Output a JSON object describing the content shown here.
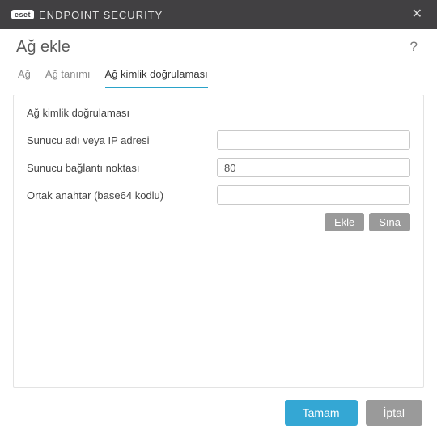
{
  "titlebar": {
    "brand_badge": "eset",
    "brand_text": "ENDPOINT SECURITY",
    "close_glyph": "✕"
  },
  "header": {
    "title": "Ağ ekle",
    "help_glyph": "?"
  },
  "tabs": [
    {
      "label": "Ağ",
      "active": false
    },
    {
      "label": "Ağ tanımı",
      "active": false
    },
    {
      "label": "Ağ kimlik doğrulaması",
      "active": true
    }
  ],
  "panel": {
    "section_heading": "Ağ kimlik doğrulaması",
    "rows": [
      {
        "label": "Sunucu adı veya IP adresi",
        "value": ""
      },
      {
        "label": "Sunucu bağlantı noktası",
        "value": "80"
      },
      {
        "label": "Ortak anahtar (base64 kodlu)",
        "value": ""
      }
    ],
    "buttons": {
      "add": "Ekle",
      "test": "Sına"
    }
  },
  "footer": {
    "ok": "Tamam",
    "cancel": "İptal"
  }
}
